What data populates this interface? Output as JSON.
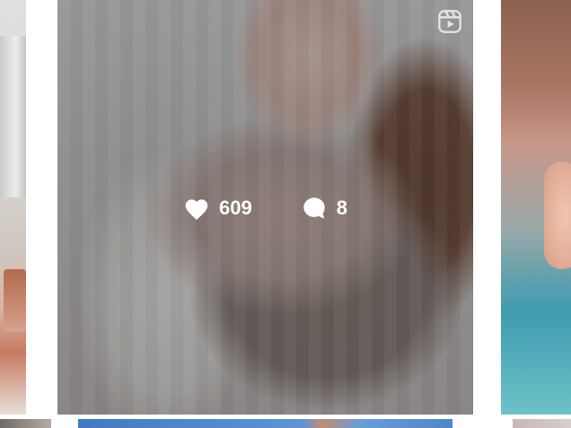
{
  "post": {
    "likes": "609",
    "comments": "8",
    "type_icon": "reels-icon"
  },
  "icons": {
    "like": "heart-icon",
    "comment": "comment-bubble-icon"
  },
  "colors": {
    "overlay_text": "#ffffff",
    "background": "#ffffff"
  }
}
